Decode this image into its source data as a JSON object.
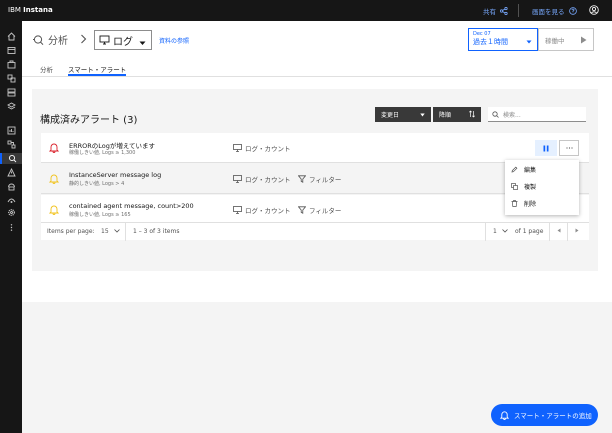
{
  "topbar": {
    "brand_prefix": "IBM",
    "brand_name": "Instana",
    "share_label": "共有",
    "docs_label": "画面を見る"
  },
  "header": {
    "breadcrumb_analysis": "分析",
    "log_select_value": "ログ",
    "reference_link": "資料の参照",
    "date_small": "Dec 07",
    "date_range": "過去１時間",
    "live_label": "稼働中",
    "tabs": [
      {
        "label": "分析",
        "active": false
      },
      {
        "label": "スマート・アラート",
        "active": true
      }
    ]
  },
  "panel": {
    "title": "構成済みアラート (3)",
    "sort_field_label": "変更日",
    "sort_order_label": "降順",
    "search_placeholder": "検索..."
  },
  "alerts": [
    {
      "name": "ERRORのLogが増えています",
      "subtitle": "稼働しきい値, Logs ≥ 1,300",
      "source": "ログ・カウント",
      "filter": "",
      "severity_color": "#da1e28",
      "paused": true
    },
    {
      "name": "InstanceServer message log",
      "subtitle": "静的しきい値, Logs > 4",
      "source": "ログ・カウント",
      "filter": "フィルター",
      "severity_color": "#f1c21b",
      "paused": false
    },
    {
      "name": "contained agent message, count>200",
      "subtitle": "稼働しきい値, Logs ≥ 165",
      "source": "ログ・カウント",
      "filter": "フィルター",
      "severity_color": "#f1c21b",
      "paused": false
    }
  ],
  "context_menu": {
    "items": [
      {
        "label": "編集",
        "icon": "pencil-icon"
      },
      {
        "label": "複製",
        "icon": "copy-icon"
      },
      {
        "label": "削除",
        "icon": "trash-icon"
      }
    ]
  },
  "pagination": {
    "items_per_page_label": "Items per page:",
    "items_per_page_value": "15",
    "range_text": "1 – 3 of 3 items",
    "page_value": "1",
    "of_pages": "of 1 page"
  },
  "fab": {
    "label": "スマート・アラートの追加"
  },
  "colors": {
    "accent": "#0f62fe",
    "nav_bg": "#161616"
  }
}
